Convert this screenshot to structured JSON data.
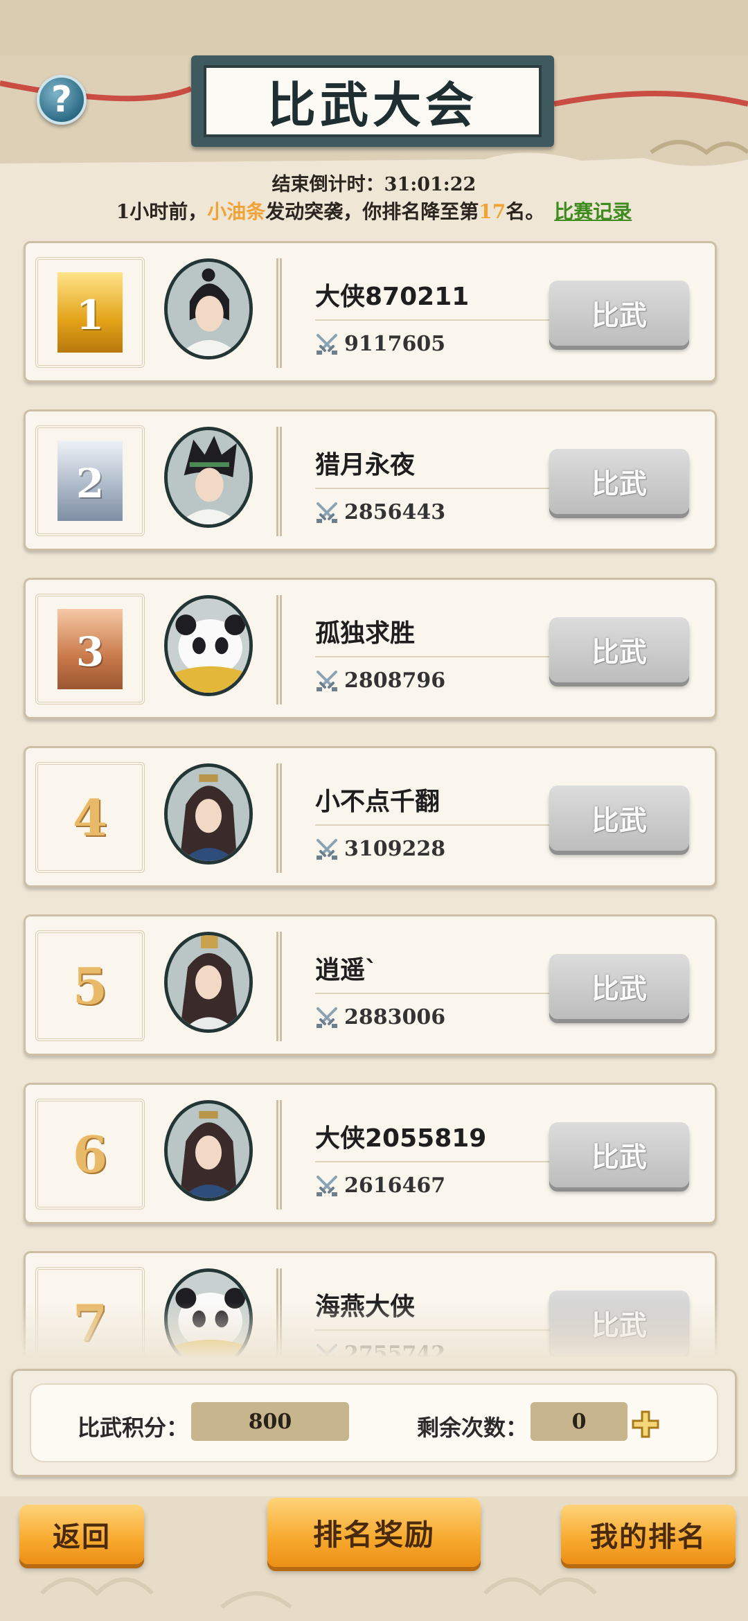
{
  "header": {
    "title": "比武大会",
    "countdown_label": "结束倒计时：",
    "countdown_value": "31:01:22"
  },
  "notice": {
    "time_ago": "1小时前，",
    "attacker": "小油条",
    "action": "发动突袭，你排名降至第",
    "rank": "17",
    "suffix": "名。",
    "record_link": "比赛记录"
  },
  "fight_label": "比武",
  "players": [
    {
      "rank": "1",
      "name": "大侠870211",
      "power": "9117605",
      "avatar": "swordsman-white"
    },
    {
      "rank": "2",
      "name": "猎月永夜",
      "power": "2856443",
      "avatar": "swordsman-green-band"
    },
    {
      "rank": "3",
      "name": "孤独求胜",
      "power": "2808796",
      "avatar": "panda"
    },
    {
      "rank": "4",
      "name": "小不点千翻",
      "power": "3109228",
      "avatar": "lady-hairpin"
    },
    {
      "rank": "5",
      "name": "逍遥`",
      "power": "2883006",
      "avatar": "lady-crown"
    },
    {
      "rank": "6",
      "name": "大侠2055819",
      "power": "2616467",
      "avatar": "lady-hairpin"
    },
    {
      "rank": "7",
      "name": "海燕大侠",
      "power": "2755742",
      "avatar": "panda"
    }
  ],
  "stats": {
    "points_label": "比武积分：",
    "points_value": "800",
    "remaining_label": "剩余次数：",
    "remaining_value": "0"
  },
  "buttons": {
    "back": "返回",
    "rewards": "排名奖励",
    "my_rank": "我的排名"
  },
  "colors": {
    "highlight": "#f0a437",
    "link": "#3d8a1d",
    "orange_button": "#f7a92e",
    "gray_button": "#c9c9c9"
  }
}
